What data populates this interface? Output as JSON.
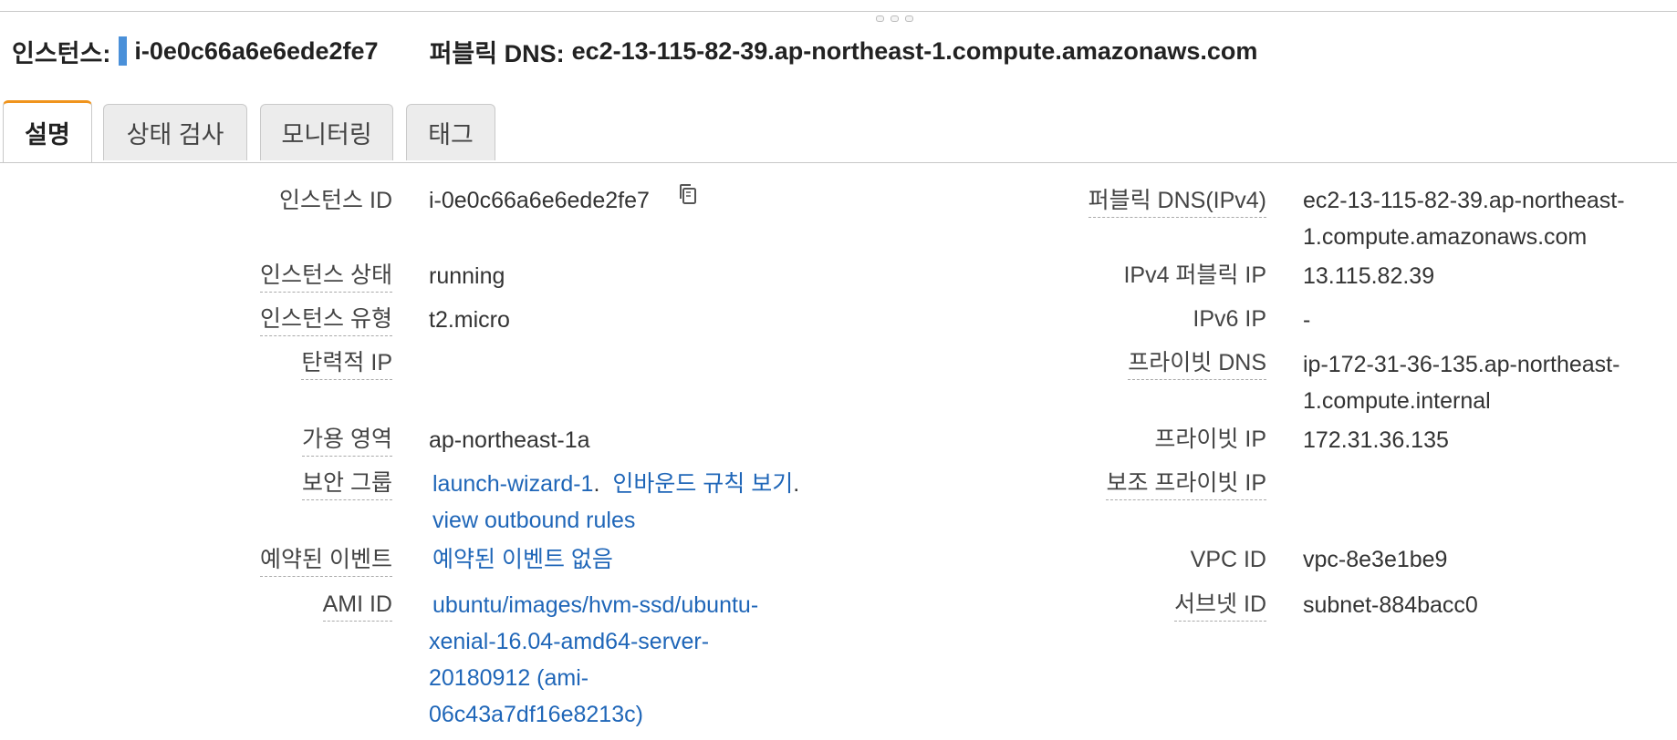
{
  "header": {
    "instance_label": "인스턴스:",
    "instance_id": "i-0e0c66a6e6ede2fe7",
    "dns_label": "퍼블릭 DNS:",
    "dns_value": "ec2-13-115-82-39.ap-northeast-1.compute.amazonaws.com"
  },
  "tabs": [
    "설명",
    "상태 검사",
    "모니터링",
    "태그"
  ],
  "colors": {
    "accent_tab": "#f0941d",
    "link": "#1f66b8",
    "marker": "#4a90d9"
  },
  "left": {
    "instance_id": {
      "label": "인스턴스 ID",
      "value": "i-0e0c66a6e6ede2fe7",
      "icon": "copy-icon"
    },
    "state": {
      "label": "인스턴스 상태",
      "value": "running"
    },
    "type": {
      "label": "인스턴스 유형",
      "value": "t2.micro"
    },
    "elastic_ip": {
      "label": "탄력적 IP",
      "value": ""
    },
    "az": {
      "label": "가용 영역",
      "value": "ap-northeast-1a"
    },
    "security_group": {
      "label": "보안 그룹",
      "group_link": "launch-wizard-1",
      "sep1": ".",
      "inbound_link": "인바운드 규칙 보기",
      "sep2": ".",
      "outbound_link": "view outbound rules"
    },
    "scheduled_events": {
      "label": "예약된 이벤트",
      "value": "예약된 이벤트 없음"
    },
    "ami": {
      "label": "AMI ID",
      "lines": [
        "ubuntu/images/hvm-ssd/ubuntu-",
        "xenial-16.04-amd64-server-",
        "20180912 (ami-",
        "06c43a7df16e8213c)"
      ]
    }
  },
  "right": {
    "public_dns": {
      "label": "퍼블릭 DNS(IPv4)",
      "lines": [
        "ec2-13-115-82-39.ap-northeast-",
        "1.compute.amazonaws.com"
      ]
    },
    "public_ip": {
      "label": "IPv4 퍼블릭 IP",
      "value": "13.115.82.39"
    },
    "ipv6": {
      "label": "IPv6 IP",
      "value": "-"
    },
    "private_dns": {
      "label": "프라이빗 DNS",
      "lines": [
        "ip-172-31-36-135.ap-northeast-",
        "1.compute.internal"
      ]
    },
    "private_ip": {
      "label": "프라이빗 IP",
      "value": "172.31.36.135"
    },
    "secondary_private_ip": {
      "label": "보조 프라이빗 IP",
      "value": ""
    },
    "vpc": {
      "label": "VPC ID",
      "value": "vpc-8e3e1be9"
    },
    "subnet": {
      "label": "서브넷 ID",
      "value": "subnet-884bacc0"
    }
  }
}
